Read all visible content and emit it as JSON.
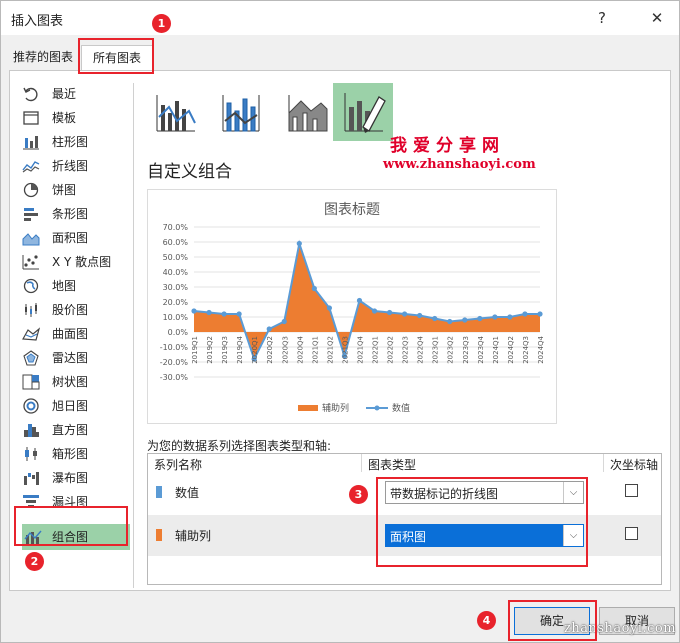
{
  "window": {
    "title": "插入图表",
    "help": "?",
    "close": "✕"
  },
  "tabs": [
    {
      "label": "推荐的图表"
    },
    {
      "label": "所有图表"
    }
  ],
  "sidebar": {
    "items": [
      {
        "label": "最近",
        "icon": "recent-icon"
      },
      {
        "label": "模板",
        "icon": "template-icon"
      },
      {
        "label": "柱形图",
        "icon": "column-chart-icon"
      },
      {
        "label": "折线图",
        "icon": "line-chart-icon"
      },
      {
        "label": "饼图",
        "icon": "pie-chart-icon"
      },
      {
        "label": "条形图",
        "icon": "bar-chart-icon"
      },
      {
        "label": "面积图",
        "icon": "area-chart-icon"
      },
      {
        "label": "X Y 散点图",
        "icon": "scatter-chart-icon"
      },
      {
        "label": "地图",
        "icon": "map-chart-icon"
      },
      {
        "label": "股价图",
        "icon": "stock-chart-icon"
      },
      {
        "label": "曲面图",
        "icon": "surface-chart-icon"
      },
      {
        "label": "雷达图",
        "icon": "radar-chart-icon"
      },
      {
        "label": "树状图",
        "icon": "treemap-chart-icon"
      },
      {
        "label": "旭日图",
        "icon": "sunburst-chart-icon"
      },
      {
        "label": "直方图",
        "icon": "histogram-chart-icon"
      },
      {
        "label": "箱形图",
        "icon": "boxplot-chart-icon"
      },
      {
        "label": "瀑布图",
        "icon": "waterfall-chart-icon"
      },
      {
        "label": "漏斗图",
        "icon": "funnel-chart-icon"
      },
      {
        "label": "组合图",
        "icon": "combo-chart-icon"
      }
    ],
    "selected": "组合图"
  },
  "main": {
    "heading": "自定义组合",
    "watermark_cn": "我爱分享网",
    "watermark_url": "www.zhanshaoyi.com"
  },
  "chart_data": {
    "type": "line",
    "title": "图表标题",
    "categories": [
      "2019Q1",
      "2019Q2",
      "2019Q3",
      "2019Q4",
      "2020Q1",
      "2020Q2",
      "2020Q3",
      "2020Q4",
      "2021Q1",
      "2021Q2",
      "2021Q3",
      "2021Q4",
      "2022Q1",
      "2022Q2",
      "2022Q3",
      "2022Q4",
      "2023Q1",
      "2023Q2",
      "2023Q3",
      "2023Q4",
      "2024Q1",
      "2024Q2",
      "2024Q3",
      "2024Q4"
    ],
    "series": [
      {
        "name": "辅助列",
        "kind": "area",
        "color": "#ed7d31",
        "values": [
          14,
          13,
          12,
          12,
          -18,
          2,
          7,
          59,
          29,
          16,
          -16,
          21,
          14,
          13,
          12,
          11,
          9,
          7,
          8,
          9,
          10,
          10,
          12,
          12
        ]
      },
      {
        "name": "数值",
        "kind": "line-markers",
        "color": "#5b9bd5",
        "values": [
          14,
          13,
          12,
          12,
          -18,
          2,
          7,
          59,
          29,
          16,
          -16,
          21,
          14,
          13,
          12,
          11,
          9,
          7,
          8,
          9,
          10,
          10,
          12,
          12
        ]
      }
    ],
    "ylim": [
      -30,
      70
    ],
    "yticks": [
      "70.0%",
      "60.0%",
      "50.0%",
      "40.0%",
      "30.0%",
      "20.0%",
      "10.0%",
      "0.0%",
      "-10.0%",
      "-20.0%",
      "-30.0%"
    ],
    "grid": true,
    "legend": "bottom"
  },
  "series_config": {
    "label": "为您的数据系列选择图表类型和轴:",
    "columns": [
      "系列名称",
      "图表类型",
      "次坐标轴"
    ],
    "rows": [
      {
        "name": "数值",
        "color": "#5b9bd5",
        "chart_type": "带数据标记的折线图",
        "secondary_axis": false
      },
      {
        "name": "辅助列",
        "color": "#ed7d31",
        "chart_type": "面积图",
        "secondary_axis": false
      }
    ]
  },
  "buttons": {
    "ok": "确定",
    "cancel": "取消"
  },
  "annotations": [
    "1",
    "2",
    "3",
    "4"
  ],
  "footer_watermark": "zhanshaoyi.com",
  "colors": {
    "accent": "#0a6fd8",
    "selected": "#9bd1a8",
    "annotation": "#e8232c"
  }
}
